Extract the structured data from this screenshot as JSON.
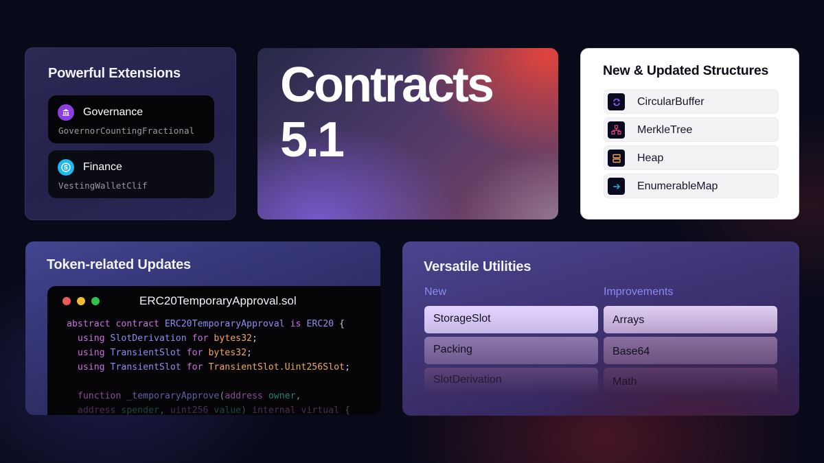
{
  "extensions": {
    "title": "Powerful Extensions",
    "items": [
      {
        "name": "Governance",
        "sub": "GovernorCountingFractional",
        "icon": "bank-icon",
        "color": "#8b3fe0"
      },
      {
        "name": "Finance",
        "sub": "VestingWalletClif",
        "icon": "dollar-coin-icon",
        "color": "#1db8f0"
      }
    ]
  },
  "hero": {
    "line1": "Contracts",
    "line2": "5.1"
  },
  "structures": {
    "title": "New & Updated Structures",
    "items": [
      {
        "label": "CircularBuffer",
        "icon": "refresh-cycle-icon",
        "color": "#8b5cf6"
      },
      {
        "label": "MerkleTree",
        "icon": "tree-nodes-icon",
        "color": "#e8467c"
      },
      {
        "label": "Heap",
        "icon": "stacked-boxes-icon",
        "color": "#f2a44a"
      },
      {
        "label": "EnumerableMap",
        "icon": "arrow-right-icon",
        "color": "#1fb0e8"
      }
    ]
  },
  "token": {
    "title": "Token-related Updates",
    "file": "ERC20TemporaryApproval.sol",
    "window_dots": [
      "#ee5a5a",
      "#f5b93a",
      "#2fc24a"
    ],
    "code": [
      [
        [
          "kw",
          "abstract contract "
        ],
        [
          "ty",
          "ERC20TemporaryApproval "
        ],
        [
          "kw",
          "is "
        ],
        [
          "ty",
          "ERC20 "
        ],
        [
          "pl",
          "{"
        ]
      ],
      [
        [
          "kw",
          "  using "
        ],
        [
          "ty",
          "SlotDerivation "
        ],
        [
          "kw",
          "for "
        ],
        [
          "or",
          "bytes32"
        ],
        [
          "pl",
          ";"
        ]
      ],
      [
        [
          "kw",
          "  using "
        ],
        [
          "ty",
          "TransientSlot "
        ],
        [
          "kw",
          "for "
        ],
        [
          "or",
          "bytes32"
        ],
        [
          "pl",
          ";"
        ]
      ],
      [
        [
          "kw",
          "  using "
        ],
        [
          "ty",
          "TransientSlot "
        ],
        [
          "kw",
          "for "
        ],
        [
          "or",
          "TransientSlot.Uint256Slot"
        ],
        [
          "pl",
          ";"
        ]
      ],
      [
        [
          "pl",
          ""
        ]
      ],
      [
        [
          "kw",
          "  function "
        ],
        [
          "ty",
          "_temporaryApprove"
        ],
        [
          "pl",
          "("
        ],
        [
          "kw",
          "address "
        ],
        [
          "tl",
          "owner"
        ],
        [
          "pl",
          ","
        ]
      ],
      [
        [
          "kw",
          "  address "
        ],
        [
          "tl",
          "spender"
        ],
        [
          "pl",
          ", "
        ],
        [
          "kw",
          "uint256 "
        ],
        [
          "tl",
          "value"
        ],
        [
          "pl",
          ") "
        ],
        [
          "kw",
          "internal virtual "
        ],
        [
          "pl",
          "{"
        ]
      ]
    ]
  },
  "utilities": {
    "title": "Versatile Utilities",
    "columns": [
      {
        "header": "New",
        "items": [
          "StorageSlot",
          "Packing",
          "SlotDerivation"
        ]
      },
      {
        "header": "Improvements",
        "items": [
          "Arrays",
          "Base64",
          "Math"
        ]
      }
    ]
  }
}
